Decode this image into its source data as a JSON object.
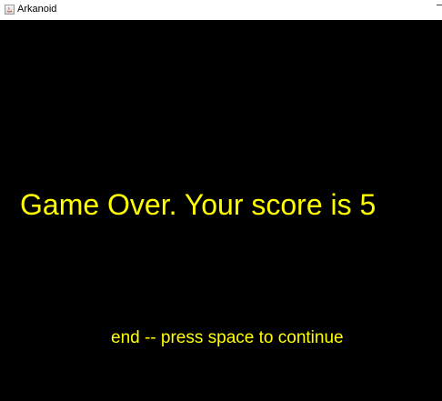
{
  "window": {
    "title": "Arkanoid"
  },
  "game": {
    "background_color": "#000000",
    "text_color": "#ffff00",
    "game_over_message": "Game Over. Your score is 5",
    "continue_prompt": "end -- press space to continue"
  }
}
